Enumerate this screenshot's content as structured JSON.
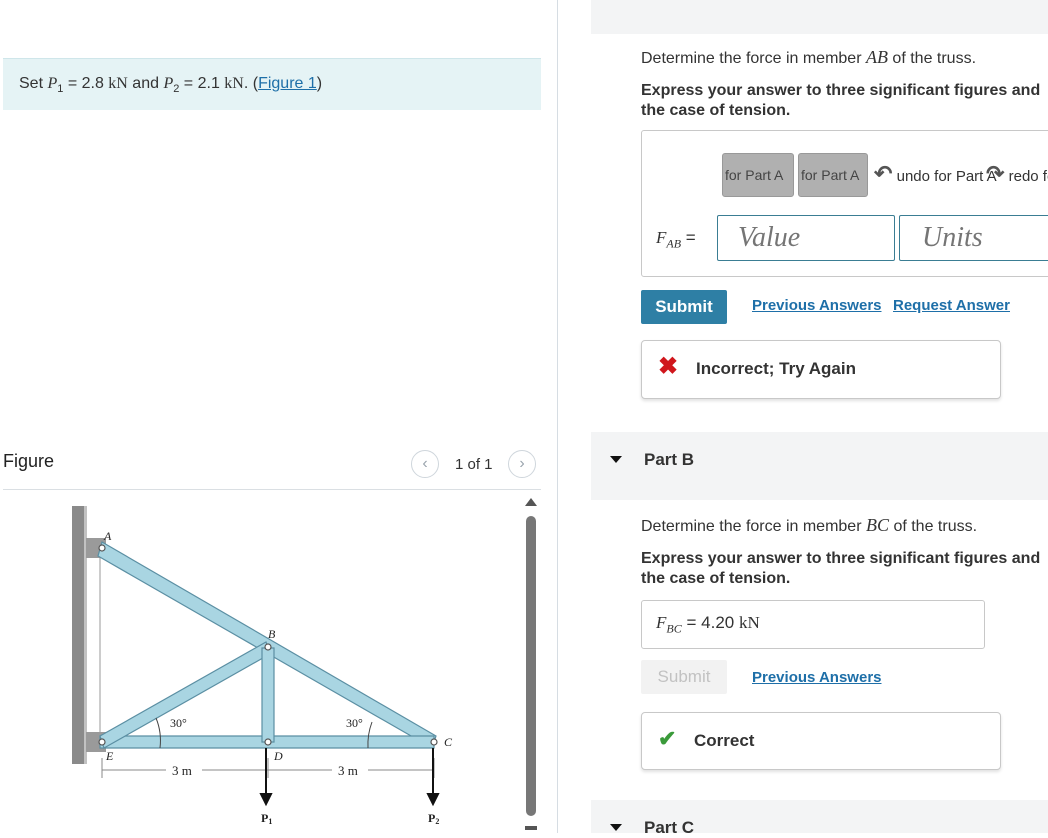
{
  "setup": {
    "prefix": "Set ",
    "p1_sym": "P",
    "p1_sub": "1",
    "p1_rest": " = 2.8 ",
    "unit": "kN",
    "and": " and ",
    "p2_sym": "P",
    "p2_sub": "2",
    "p2_rest": " = 2.1 ",
    "period": ".",
    "open": " (",
    "figure_link": "Figure 1",
    "close": ")"
  },
  "figure": {
    "title": "Figure",
    "pager": "1 of 1",
    "prev_icon": "chevron-left-icon",
    "next_icon": "chevron-right-icon",
    "labels": {
      "A": "A",
      "B": "B",
      "C": "C",
      "D": "D",
      "E": "E",
      "angle_left": "30°",
      "angle_right": "30°",
      "dim_left": "3 m",
      "dim_right": "3 m",
      "P1": "P",
      "P1_sub": "1",
      "P2": "P",
      "P2_sub": "2"
    }
  },
  "partA": {
    "question_pre": "Determine the force in member ",
    "member": "AB",
    "question_post": " of the truss.",
    "instructions": "Express your answer to three significant figures and",
    "instructions2": "the case of tension.",
    "toolbar": {
      "templates": "for Part A",
      "symbols": "for Part A",
      "undo": "undo for Part A",
      "redo": "redo for"
    },
    "var_sym": "F",
    "var_sub": "AB",
    "equals": "=",
    "value_placeholder": "Value",
    "units_placeholder": "Units",
    "submit": "Submit",
    "previous_answers": "Previous Answers",
    "request_answer": "Request Answer",
    "feedback": "Incorrect; Try Again"
  },
  "partB": {
    "title": "Part B",
    "question_pre": "Determine the force in member ",
    "member": "BC",
    "question_post": " of the truss.",
    "instructions": "Express your answer to three significant figures and",
    "instructions2": "the case of tension.",
    "var_sym": "F",
    "var_sub": "BC",
    "equals": "=",
    "answer_value": "4.20",
    "answer_unit": "kN",
    "submit": "Submit",
    "previous_answers": "Previous Answers",
    "feedback": "Correct"
  },
  "partC": {
    "title": "Part C"
  },
  "colors": {
    "accent": "#2e7fa5",
    "link": "#1e6fa8",
    "incorrect": "#d0161c",
    "correct": "#3a9a3a",
    "truss_member": "#a9d5e2"
  }
}
